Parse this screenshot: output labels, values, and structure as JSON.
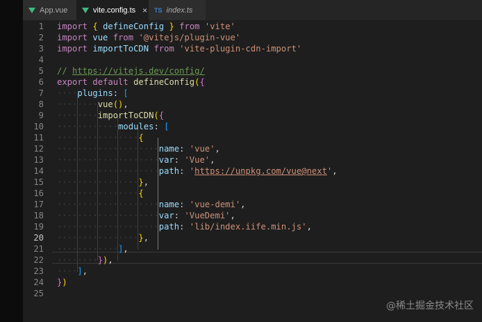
{
  "colors": {
    "accent": "#41b883",
    "ts_blue": "#3a7fd1",
    "string": "#ce9178",
    "keyword": "#c586c0",
    "variable": "#9cdcfe",
    "function": "#dcdcaa",
    "comment": "#6a9955"
  },
  "tabs": [
    {
      "label": "App.vue",
      "icon": "vue-icon",
      "active": false
    },
    {
      "label": "vite.config.ts",
      "icon": "vue-icon",
      "active": true,
      "close": "×"
    },
    {
      "label": "index.ts",
      "icon": "ts-icon",
      "icon_text": "TS",
      "active": false
    }
  ],
  "editor": {
    "current_line": 20,
    "lines": [
      {
        "n": "1",
        "t": [
          [
            "kw",
            "import"
          ],
          [
            "pu",
            " "
          ],
          [
            "b1",
            "{"
          ],
          [
            "pu",
            " "
          ],
          [
            "vb",
            "defineConfig"
          ],
          [
            "pu",
            " "
          ],
          [
            "b1",
            "}"
          ],
          [
            "pu",
            " "
          ],
          [
            "kw",
            "from"
          ],
          [
            "pu",
            " "
          ],
          [
            "st",
            "'vite'"
          ]
        ]
      },
      {
        "n": "2",
        "t": [
          [
            "kw",
            "import"
          ],
          [
            "pu",
            " "
          ],
          [
            "vb",
            "vue"
          ],
          [
            "pu",
            " "
          ],
          [
            "kw",
            "from"
          ],
          [
            "pu",
            " "
          ],
          [
            "st",
            "'@vitejs/plugin-vue'"
          ]
        ]
      },
      {
        "n": "3",
        "t": [
          [
            "kw",
            "import"
          ],
          [
            "pu",
            " "
          ],
          [
            "vb",
            "importToCDN"
          ],
          [
            "pu",
            " "
          ],
          [
            "kw",
            "from"
          ],
          [
            "pu",
            " "
          ],
          [
            "st",
            "'vite-plugin-cdn-import'"
          ]
        ]
      },
      {
        "n": "4",
        "t": []
      },
      {
        "n": "5",
        "t": [
          [
            "cm",
            "// "
          ],
          [
            "cm ul",
            "https://vitejs.dev/config/"
          ]
        ]
      },
      {
        "n": "6",
        "t": [
          [
            "kw",
            "export"
          ],
          [
            "pu",
            " "
          ],
          [
            "kw",
            "default"
          ],
          [
            "pu",
            " "
          ],
          [
            "fn",
            "defineConfig"
          ],
          [
            "b1",
            "("
          ],
          [
            "b2",
            "{"
          ]
        ]
      },
      {
        "n": "7",
        "t": [
          [
            "dot",
            "····"
          ],
          [
            "vb",
            "plugins"
          ],
          [
            "pu",
            ": "
          ],
          [
            "b3",
            "["
          ]
        ]
      },
      {
        "n": "8",
        "t": [
          [
            "dot",
            "········"
          ],
          [
            "fn",
            "vue"
          ],
          [
            "b1",
            "()"
          ],
          [
            "pu",
            ","
          ]
        ]
      },
      {
        "n": "9",
        "t": [
          [
            "dot",
            "········"
          ],
          [
            "fn",
            "importToCDN"
          ],
          [
            "b1",
            "("
          ],
          [
            "b2",
            "{"
          ]
        ]
      },
      {
        "n": "10",
        "t": [
          [
            "dot",
            "············"
          ],
          [
            "vb",
            "modules"
          ],
          [
            "pu",
            ": "
          ],
          [
            "b3",
            "["
          ]
        ]
      },
      {
        "n": "11",
        "t": [
          [
            "dot",
            "················"
          ],
          [
            "b1",
            "{"
          ]
        ]
      },
      {
        "n": "12",
        "t": [
          [
            "dot",
            "····················"
          ],
          [
            "vb",
            "name"
          ],
          [
            "pu",
            ": "
          ],
          [
            "st",
            "'vue'"
          ],
          [
            "pu",
            ","
          ]
        ]
      },
      {
        "n": "13",
        "t": [
          [
            "dot",
            "····················"
          ],
          [
            "vb",
            "var"
          ],
          [
            "pu",
            ": "
          ],
          [
            "st",
            "'Vue'"
          ],
          [
            "pu",
            ","
          ]
        ]
      },
      {
        "n": "14",
        "t": [
          [
            "dot",
            "····················"
          ],
          [
            "vb",
            "path"
          ],
          [
            "pu",
            ": "
          ],
          [
            "st",
            "'"
          ],
          [
            "st ul",
            "https://unpkg.com/vue@next"
          ],
          [
            "st",
            "'"
          ],
          [
            "pu",
            ","
          ]
        ]
      },
      {
        "n": "15",
        "t": [
          [
            "dot",
            "················"
          ],
          [
            "b1",
            "}"
          ],
          [
            "pu",
            ","
          ]
        ]
      },
      {
        "n": "16",
        "t": [
          [
            "dot",
            "················"
          ],
          [
            "b1",
            "{"
          ]
        ]
      },
      {
        "n": "17",
        "t": [
          [
            "dot",
            "····················"
          ],
          [
            "vb",
            "name"
          ],
          [
            "pu",
            ": "
          ],
          [
            "st",
            "'vue-demi'"
          ],
          [
            "pu",
            ","
          ]
        ]
      },
      {
        "n": "18",
        "t": [
          [
            "dot",
            "····················"
          ],
          [
            "vb",
            "var"
          ],
          [
            "pu",
            ": "
          ],
          [
            "st",
            "'VueDemi'"
          ],
          [
            "pu",
            ","
          ]
        ]
      },
      {
        "n": "19",
        "t": [
          [
            "dot",
            "····················"
          ],
          [
            "vb",
            "path"
          ],
          [
            "pu",
            ": "
          ],
          [
            "st",
            "'lib/index.iife.min.js'"
          ],
          [
            "pu",
            ","
          ]
        ]
      },
      {
        "n": "20",
        "t": [
          [
            "dot",
            "················"
          ],
          [
            "b1",
            "}"
          ],
          [
            "pu",
            ","
          ]
        ]
      },
      {
        "n": "21",
        "t": [
          [
            "dot",
            "············"
          ],
          [
            "b3",
            "]"
          ],
          [
            "pu",
            ","
          ]
        ]
      },
      {
        "n": "22",
        "t": [
          [
            "dot",
            "········"
          ],
          [
            "b2",
            "}"
          ],
          [
            "b1",
            ")"
          ],
          [
            "pu",
            ","
          ]
        ]
      },
      {
        "n": "23",
        "t": [
          [
            "dot",
            "····"
          ],
          [
            "b3",
            "]"
          ],
          [
            "pu",
            ","
          ]
        ]
      },
      {
        "n": "24",
        "t": [
          [
            "b2",
            "}"
          ],
          [
            "b1",
            ")"
          ]
        ]
      },
      {
        "n": "25",
        "t": []
      }
    ]
  },
  "watermark": "@稀土掘金技术社区"
}
